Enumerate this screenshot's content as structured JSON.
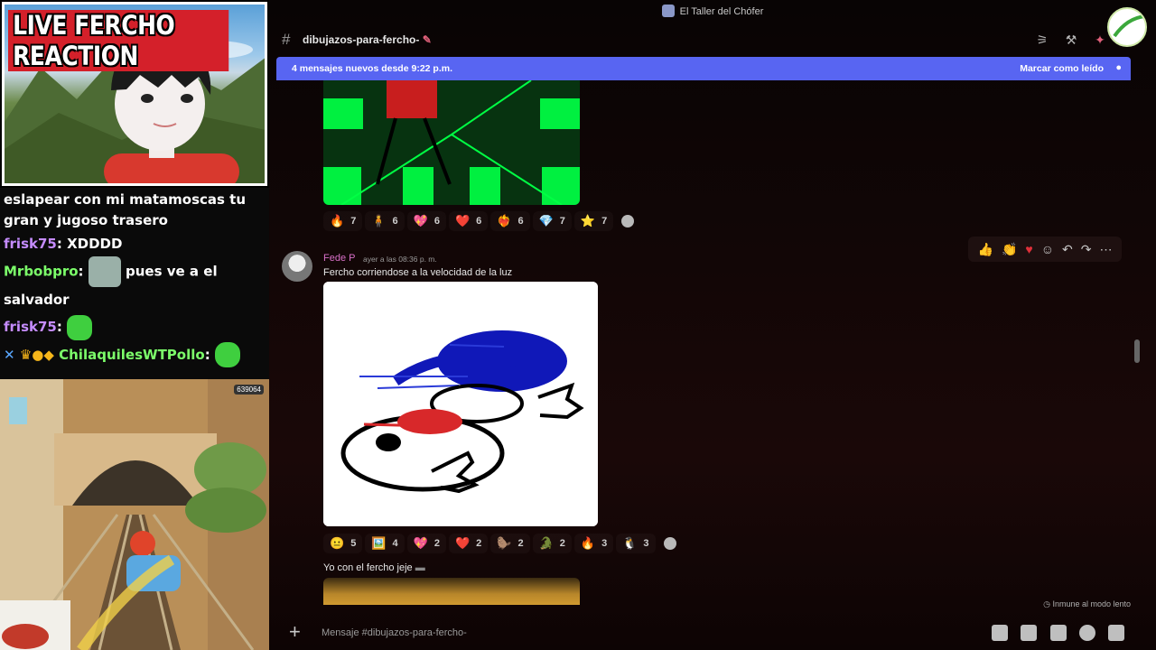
{
  "stream": {
    "title": "LIVE FERCHO REACTION",
    "chat": [
      {
        "user": "",
        "text": "eslapear con mi matamoscas tu gran y jugoso trasero"
      },
      {
        "user": "frisk75",
        "text": "XDDDD"
      },
      {
        "user": "Mrbobpro",
        "text": "pues ve a el salvador"
      },
      {
        "user": "frisk75",
        "text": ""
      },
      {
        "user": "ChilaquilesWTPollo",
        "text": ""
      }
    ],
    "game_score": "639064"
  },
  "discord": {
    "server_name": "El Taller del Chófer",
    "channel_name": "dibujazos-para-fercho-",
    "new_messages_text": "4 mensajes nuevos desde 9:22 p.m.",
    "mark_read_label": "Marcar como leído",
    "reactions_1": [
      {
        "emoji": "🔥",
        "count": "7"
      },
      {
        "emoji": "🧍",
        "count": "6"
      },
      {
        "emoji": "💖",
        "count": "6"
      },
      {
        "emoji": "❤️",
        "count": "6"
      },
      {
        "emoji": "❤️‍🔥",
        "count": "6"
      },
      {
        "emoji": "💎",
        "count": "7"
      },
      {
        "emoji": "⭐",
        "count": "7"
      }
    ],
    "message2": {
      "author": "Fede P",
      "timestamp": "ayer a las 08:36 p. m.",
      "text": "Fercho corriendose a la velocidad de la luz"
    },
    "reactions_2": [
      {
        "emoji": "😐",
        "count": "5"
      },
      {
        "emoji": "🖼️",
        "count": "4"
      },
      {
        "emoji": "💖",
        "count": "2"
      },
      {
        "emoji": "❤️",
        "count": "2"
      },
      {
        "emoji": "🦫",
        "count": "2"
      },
      {
        "emoji": "🐊",
        "count": "2"
      },
      {
        "emoji": "🔥",
        "count": "3"
      },
      {
        "emoji": "🐧",
        "count": "3"
      }
    ],
    "message3_text": "Yo con el fercho jeje",
    "slowmode_text": "Inmune al modo lento",
    "composer_placeholder": "Mensaje #dibujazos-para-fercho-"
  }
}
